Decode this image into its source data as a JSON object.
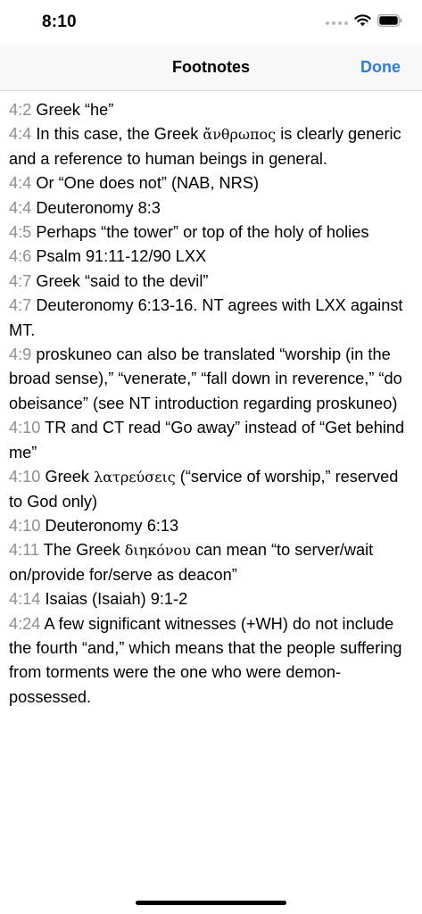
{
  "status_bar": {
    "time": "8:10",
    "icons": [
      "signal-dots-icon",
      "wifi-icon",
      "battery-icon"
    ]
  },
  "nav": {
    "title": "Footnotes",
    "done_label": "Done"
  },
  "footnotes": [
    {
      "ref": "4:2",
      "text": "Greek “he”"
    },
    {
      "ref": "4:4",
      "before": "In this case, the Greek",
      "greek": "ἄνθρωπος",
      "after": "is clearly generic and a reference to human beings in general."
    },
    {
      "ref": "4:4",
      "text": "Or “One does not” (NAB, NRS)"
    },
    {
      "ref": "4:4",
      "text": "Deuteronomy 8:3"
    },
    {
      "ref": "4:5",
      "text": "Perhaps “the tower” or top of the holy of holies"
    },
    {
      "ref": "4:6",
      "text": "Psalm 91:11-12/90 LXX"
    },
    {
      "ref": "4:7",
      "text": "Greek “said to the devil”"
    },
    {
      "ref": "4:7",
      "text": "Deuteronomy 6:13-16. NT agrees with LXX against MT."
    },
    {
      "ref": "4:9",
      "text": "proskuneo can also be translated “worship (in the broad sense),” “venerate,” “fall down in reverence,” “do obeisance” (see NT introduction regarding proskuneo)"
    },
    {
      "ref": "4:10",
      "text": "TR and CT read “Go away” instead of “Get behind me”"
    },
    {
      "ref": "4:10",
      "before": "Greek",
      "greek": "λατρεύσεις",
      "after": " (“service of worship,” reserved to God only)"
    },
    {
      "ref": "4:10",
      "text": "Deuteronomy 6:13"
    },
    {
      "ref": "4:11",
      "before": "The Greek",
      "greek": "διηκόνου",
      "after": "can mean “to server/wait on/provide for/serve as deacon”"
    },
    {
      "ref": "4:14",
      "text": "Isaias (Isaiah) 9:1-2"
    },
    {
      "ref": "4:24",
      "text": "A few significant witnesses (+WH) do not include the fourth “and,” which means that the people suffering from torments were the one who were demon-possessed."
    }
  ],
  "colors": {
    "accent": "#2f7bd8",
    "reference": "#8e8e8e",
    "nav_background": "#f8f8f8"
  }
}
